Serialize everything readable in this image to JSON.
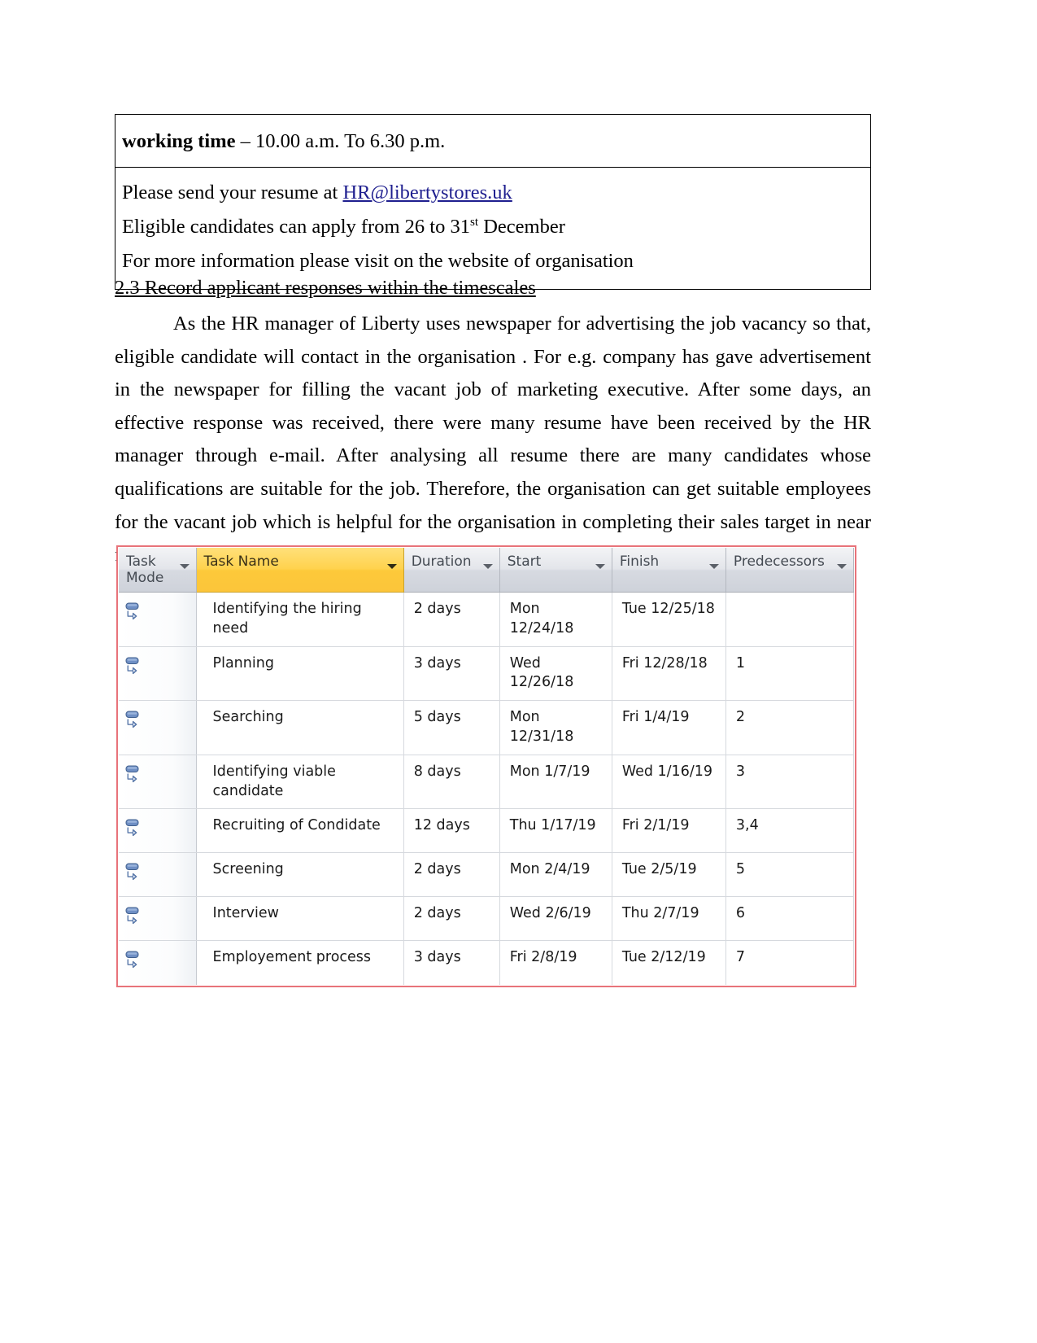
{
  "info_box": {
    "line_working_time_bold": "working time",
    "line_working_time_rest": " – 10.00 a.m. To 6.30 p.m.",
    "line_resume_prefix": "Please send your resume at ",
    "line_resume_link": "HR@libertystores.uk",
    "line_apply_prefix": "Eligible candidates can apply from 26 to 31",
    "line_apply_ordinal": "st",
    "line_apply_suffix": " December",
    "line_more_info": "For more information please visit on the website of organisation"
  },
  "heading": "2.3 Record applicant responses within the timescales",
  "paragraph": "As the HR manager of Liberty uses newspaper for advertising the job vacancy so that, eligible candidate will contact in the organisation . For e.g. company has gave advertisement in the newspaper for filling the vacant job of marketing executive. After some days, an effective response was received, there were many resume have been received by the HR manager through e-mail. After analysing all resume there are many candidates whose qualifications are suitable for the job. Therefore, the organisation can get suitable employees for the vacant job which is helpful for the organisation in completing their sales target in near future.",
  "project_table": {
    "accent_border_color": "#e8737a",
    "highlight_column_color": "#fdc93a",
    "columns": [
      {
        "key": "task_mode",
        "label": "Task Mode",
        "highlight": false,
        "has_filter": true
      },
      {
        "key": "task_name",
        "label": "Task Name",
        "highlight": true,
        "has_filter": true
      },
      {
        "key": "duration",
        "label": "Duration",
        "highlight": false,
        "has_filter": true
      },
      {
        "key": "start",
        "label": "Start",
        "highlight": false,
        "has_filter": true
      },
      {
        "key": "finish",
        "label": "Finish",
        "highlight": false,
        "has_filter": true
      },
      {
        "key": "predecessors",
        "label": "Predecessors",
        "highlight": false,
        "has_filter": true
      }
    ],
    "rows": [
      {
        "mode_icon": "auto-scheduled-icon",
        "task_name": "Identifying the hiring need",
        "duration": "2 days",
        "start": "Mon 12/24/18",
        "finish": "Tue 12/25/18",
        "predecessors": ""
      },
      {
        "mode_icon": "auto-scheduled-icon",
        "task_name": "Planning",
        "duration": "3 days",
        "start": "Wed 12/26/18",
        "finish": "Fri 12/28/18",
        "predecessors": "1"
      },
      {
        "mode_icon": "auto-scheduled-icon",
        "task_name": "Searching",
        "duration": "5 days",
        "start": "Mon 12/31/18",
        "finish": "Fri 1/4/19",
        "predecessors": "2"
      },
      {
        "mode_icon": "auto-scheduled-icon",
        "task_name": "Identifying viable candidate",
        "duration": "8 days",
        "start": "Mon 1/7/19",
        "finish": "Wed 1/16/19",
        "predecessors": "3"
      },
      {
        "mode_icon": "auto-scheduled-icon",
        "task_name": "Recruiting of Condidate",
        "duration": "12 days",
        "start": "Thu 1/17/19",
        "finish": "Fri 2/1/19",
        "predecessors": "3,4"
      },
      {
        "mode_icon": "auto-scheduled-icon",
        "task_name": "Screening",
        "duration": "2 days",
        "start": "Mon 2/4/19",
        "finish": "Tue 2/5/19",
        "predecessors": "5"
      },
      {
        "mode_icon": "auto-scheduled-icon",
        "task_name": "Interview",
        "duration": "2 days",
        "start": "Wed 2/6/19",
        "finish": "Thu 2/7/19",
        "predecessors": "6"
      },
      {
        "mode_icon": "auto-scheduled-icon",
        "task_name": "Employement process",
        "duration": "3 days",
        "start": "Fri 2/8/19",
        "finish": "Tue 2/12/19",
        "predecessors": "7"
      }
    ]
  }
}
